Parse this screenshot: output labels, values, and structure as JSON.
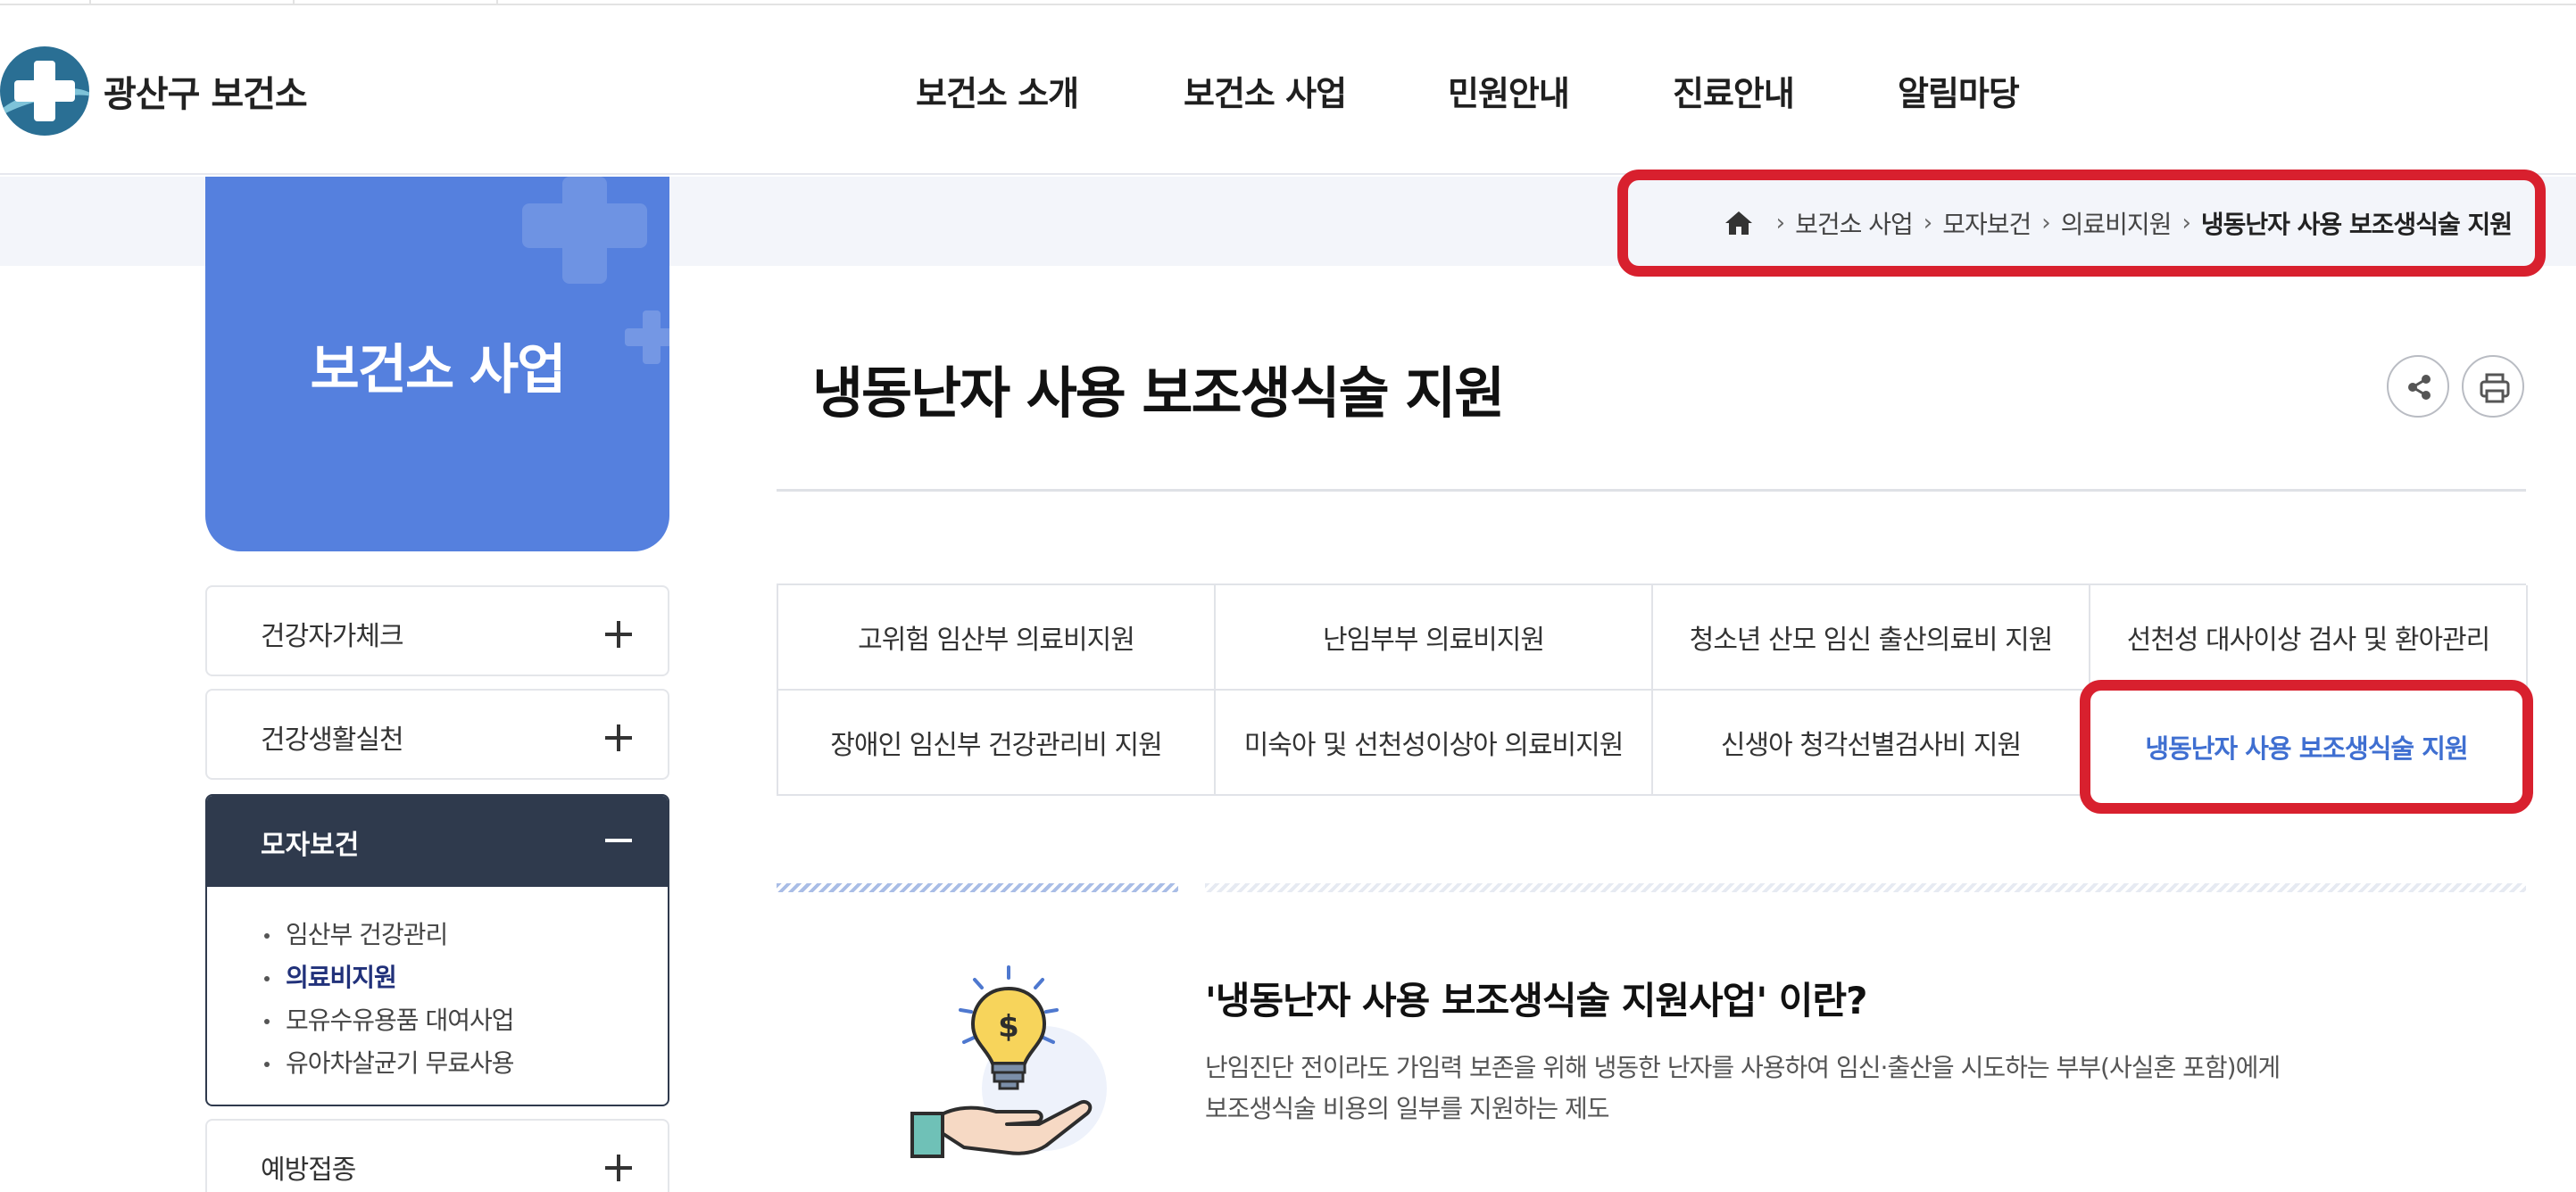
{
  "site": {
    "name": "광산구 보건소"
  },
  "gnb": [
    "보건소 소개",
    "보건소 사업",
    "민원안내",
    "진료안내",
    "알림마당"
  ],
  "side": {
    "title": "보건소 사업",
    "menu": [
      {
        "label": "건강자가체크"
      },
      {
        "label": "건강생활실천"
      },
      {
        "label": "모자보건",
        "children": [
          "임산부 건강관리",
          "의료비지원",
          "모유수유용품 대여사업",
          "유아차살균기 무료사용"
        ],
        "active_child": "의료비지원"
      },
      {
        "label": "예방접종"
      }
    ]
  },
  "breadcrumb": [
    "보건소 사업",
    "모자보건",
    "의료비지원",
    "냉동난자 사용 보조생식술 지원"
  ],
  "page": {
    "title": "냉동난자 사용 보조생식술 지원"
  },
  "tabs": [
    "고위험 임산부 의료비지원",
    "난임부부 의료비지원",
    "청소년 산모 임신 출산의료비 지원",
    "선천성 대사이상 검사 및 환아관리",
    "장애인 임신부 건강관리비 지원",
    "미숙아 및 선천성이상아 의료비지원",
    "신생아 청각선별검사비 지원",
    "냉동난자 사용 보조생식술 지원"
  ],
  "active_tab": "냉동난자 사용 보조생식술 지원",
  "intro": {
    "title": "'냉동난자 사용 보조생식술 지원사업' 이란?",
    "desc_lines": [
      "난임진단 전이라도 가임력 보존을 위해 냉동한 난자를 사용하여 임신·출산을 시도하는 부부(사실혼 포함)에게",
      "보조생식술 비용의 일부를 지원하는 제도"
    ]
  },
  "icons": [
    "home-icon",
    "share-icon",
    "print-icon",
    "plus-icon",
    "minus-icon",
    "lightbulb-dollar-icon"
  ],
  "colors": {
    "brand_blue": "#5580de",
    "menu_dark": "#2f3a4d",
    "highlight_red": "#d8202e",
    "active_tab_text": "#3f6fd1"
  }
}
